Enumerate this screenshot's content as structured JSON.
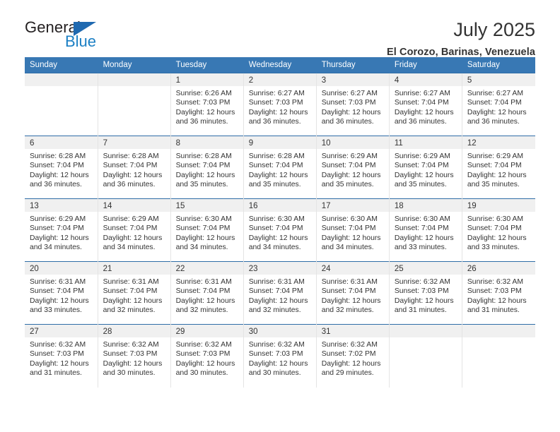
{
  "logo": {
    "word_one": "General",
    "word_two": "Blue",
    "triangle_color": "#1f69b0",
    "blue_text_color": "#1b7fc4"
  },
  "header": {
    "title": "July 2025",
    "subtitle": "El Corozo, Barinas, Venezuela"
  },
  "theme": {
    "header_band": "#3878b4",
    "week_divider": "#2f6da7",
    "daynum_strip": "#f0f0f0",
    "cell_divider": "#e4e4e4",
    "text": "#333333"
  },
  "weekday_headers": [
    "Sunday",
    "Monday",
    "Tuesday",
    "Wednesday",
    "Thursday",
    "Friday",
    "Saturday"
  ],
  "labels": {
    "sunrise_prefix": "Sunrise:",
    "sunset_prefix": "Sunset:",
    "daylight_prefix": "Daylight:"
  },
  "weeks": [
    [
      {
        "day": "",
        "empty": true
      },
      {
        "day": "",
        "empty": true
      },
      {
        "day": "1",
        "sunrise": "Sunrise: 6:26 AM",
        "sunset": "Sunset: 7:03 PM",
        "daylight_line1": "Daylight: 12 hours",
        "daylight_line2": "and 36 minutes."
      },
      {
        "day": "2",
        "sunrise": "Sunrise: 6:27 AM",
        "sunset": "Sunset: 7:03 PM",
        "daylight_line1": "Daylight: 12 hours",
        "daylight_line2": "and 36 minutes."
      },
      {
        "day": "3",
        "sunrise": "Sunrise: 6:27 AM",
        "sunset": "Sunset: 7:03 PM",
        "daylight_line1": "Daylight: 12 hours",
        "daylight_line2": "and 36 minutes."
      },
      {
        "day": "4",
        "sunrise": "Sunrise: 6:27 AM",
        "sunset": "Sunset: 7:04 PM",
        "daylight_line1": "Daylight: 12 hours",
        "daylight_line2": "and 36 minutes."
      },
      {
        "day": "5",
        "sunrise": "Sunrise: 6:27 AM",
        "sunset": "Sunset: 7:04 PM",
        "daylight_line1": "Daylight: 12 hours",
        "daylight_line2": "and 36 minutes."
      }
    ],
    [
      {
        "day": "6",
        "sunrise": "Sunrise: 6:28 AM",
        "sunset": "Sunset: 7:04 PM",
        "daylight_line1": "Daylight: 12 hours",
        "daylight_line2": "and 36 minutes."
      },
      {
        "day": "7",
        "sunrise": "Sunrise: 6:28 AM",
        "sunset": "Sunset: 7:04 PM",
        "daylight_line1": "Daylight: 12 hours",
        "daylight_line2": "and 36 minutes."
      },
      {
        "day": "8",
        "sunrise": "Sunrise: 6:28 AM",
        "sunset": "Sunset: 7:04 PM",
        "daylight_line1": "Daylight: 12 hours",
        "daylight_line2": "and 35 minutes."
      },
      {
        "day": "9",
        "sunrise": "Sunrise: 6:28 AM",
        "sunset": "Sunset: 7:04 PM",
        "daylight_line1": "Daylight: 12 hours",
        "daylight_line2": "and 35 minutes."
      },
      {
        "day": "10",
        "sunrise": "Sunrise: 6:29 AM",
        "sunset": "Sunset: 7:04 PM",
        "daylight_line1": "Daylight: 12 hours",
        "daylight_line2": "and 35 minutes."
      },
      {
        "day": "11",
        "sunrise": "Sunrise: 6:29 AM",
        "sunset": "Sunset: 7:04 PM",
        "daylight_line1": "Daylight: 12 hours",
        "daylight_line2": "and 35 minutes."
      },
      {
        "day": "12",
        "sunrise": "Sunrise: 6:29 AM",
        "sunset": "Sunset: 7:04 PM",
        "daylight_line1": "Daylight: 12 hours",
        "daylight_line2": "and 35 minutes."
      }
    ],
    [
      {
        "day": "13",
        "sunrise": "Sunrise: 6:29 AM",
        "sunset": "Sunset: 7:04 PM",
        "daylight_line1": "Daylight: 12 hours",
        "daylight_line2": "and 34 minutes."
      },
      {
        "day": "14",
        "sunrise": "Sunrise: 6:29 AM",
        "sunset": "Sunset: 7:04 PM",
        "daylight_line1": "Daylight: 12 hours",
        "daylight_line2": "and 34 minutes."
      },
      {
        "day": "15",
        "sunrise": "Sunrise: 6:30 AM",
        "sunset": "Sunset: 7:04 PM",
        "daylight_line1": "Daylight: 12 hours",
        "daylight_line2": "and 34 minutes."
      },
      {
        "day": "16",
        "sunrise": "Sunrise: 6:30 AM",
        "sunset": "Sunset: 7:04 PM",
        "daylight_line1": "Daylight: 12 hours",
        "daylight_line2": "and 34 minutes."
      },
      {
        "day": "17",
        "sunrise": "Sunrise: 6:30 AM",
        "sunset": "Sunset: 7:04 PM",
        "daylight_line1": "Daylight: 12 hours",
        "daylight_line2": "and 34 minutes."
      },
      {
        "day": "18",
        "sunrise": "Sunrise: 6:30 AM",
        "sunset": "Sunset: 7:04 PM",
        "daylight_line1": "Daylight: 12 hours",
        "daylight_line2": "and 33 minutes."
      },
      {
        "day": "19",
        "sunrise": "Sunrise: 6:30 AM",
        "sunset": "Sunset: 7:04 PM",
        "daylight_line1": "Daylight: 12 hours",
        "daylight_line2": "and 33 minutes."
      }
    ],
    [
      {
        "day": "20",
        "sunrise": "Sunrise: 6:31 AM",
        "sunset": "Sunset: 7:04 PM",
        "daylight_line1": "Daylight: 12 hours",
        "daylight_line2": "and 33 minutes."
      },
      {
        "day": "21",
        "sunrise": "Sunrise: 6:31 AM",
        "sunset": "Sunset: 7:04 PM",
        "daylight_line1": "Daylight: 12 hours",
        "daylight_line2": "and 32 minutes."
      },
      {
        "day": "22",
        "sunrise": "Sunrise: 6:31 AM",
        "sunset": "Sunset: 7:04 PM",
        "daylight_line1": "Daylight: 12 hours",
        "daylight_line2": "and 32 minutes."
      },
      {
        "day": "23",
        "sunrise": "Sunrise: 6:31 AM",
        "sunset": "Sunset: 7:04 PM",
        "daylight_line1": "Daylight: 12 hours",
        "daylight_line2": "and 32 minutes."
      },
      {
        "day": "24",
        "sunrise": "Sunrise: 6:31 AM",
        "sunset": "Sunset: 7:04 PM",
        "daylight_line1": "Daylight: 12 hours",
        "daylight_line2": "and 32 minutes."
      },
      {
        "day": "25",
        "sunrise": "Sunrise: 6:32 AM",
        "sunset": "Sunset: 7:03 PM",
        "daylight_line1": "Daylight: 12 hours",
        "daylight_line2": "and 31 minutes."
      },
      {
        "day": "26",
        "sunrise": "Sunrise: 6:32 AM",
        "sunset": "Sunset: 7:03 PM",
        "daylight_line1": "Daylight: 12 hours",
        "daylight_line2": "and 31 minutes."
      }
    ],
    [
      {
        "day": "27",
        "sunrise": "Sunrise: 6:32 AM",
        "sunset": "Sunset: 7:03 PM",
        "daylight_line1": "Daylight: 12 hours",
        "daylight_line2": "and 31 minutes."
      },
      {
        "day": "28",
        "sunrise": "Sunrise: 6:32 AM",
        "sunset": "Sunset: 7:03 PM",
        "daylight_line1": "Daylight: 12 hours",
        "daylight_line2": "and 30 minutes."
      },
      {
        "day": "29",
        "sunrise": "Sunrise: 6:32 AM",
        "sunset": "Sunset: 7:03 PM",
        "daylight_line1": "Daylight: 12 hours",
        "daylight_line2": "and 30 minutes."
      },
      {
        "day": "30",
        "sunrise": "Sunrise: 6:32 AM",
        "sunset": "Sunset: 7:03 PM",
        "daylight_line1": "Daylight: 12 hours",
        "daylight_line2": "and 30 minutes."
      },
      {
        "day": "31",
        "sunrise": "Sunrise: 6:32 AM",
        "sunset": "Sunset: 7:02 PM",
        "daylight_line1": "Daylight: 12 hours",
        "daylight_line2": "and 29 minutes."
      },
      {
        "day": "",
        "empty": true
      },
      {
        "day": "",
        "empty": true
      }
    ]
  ]
}
